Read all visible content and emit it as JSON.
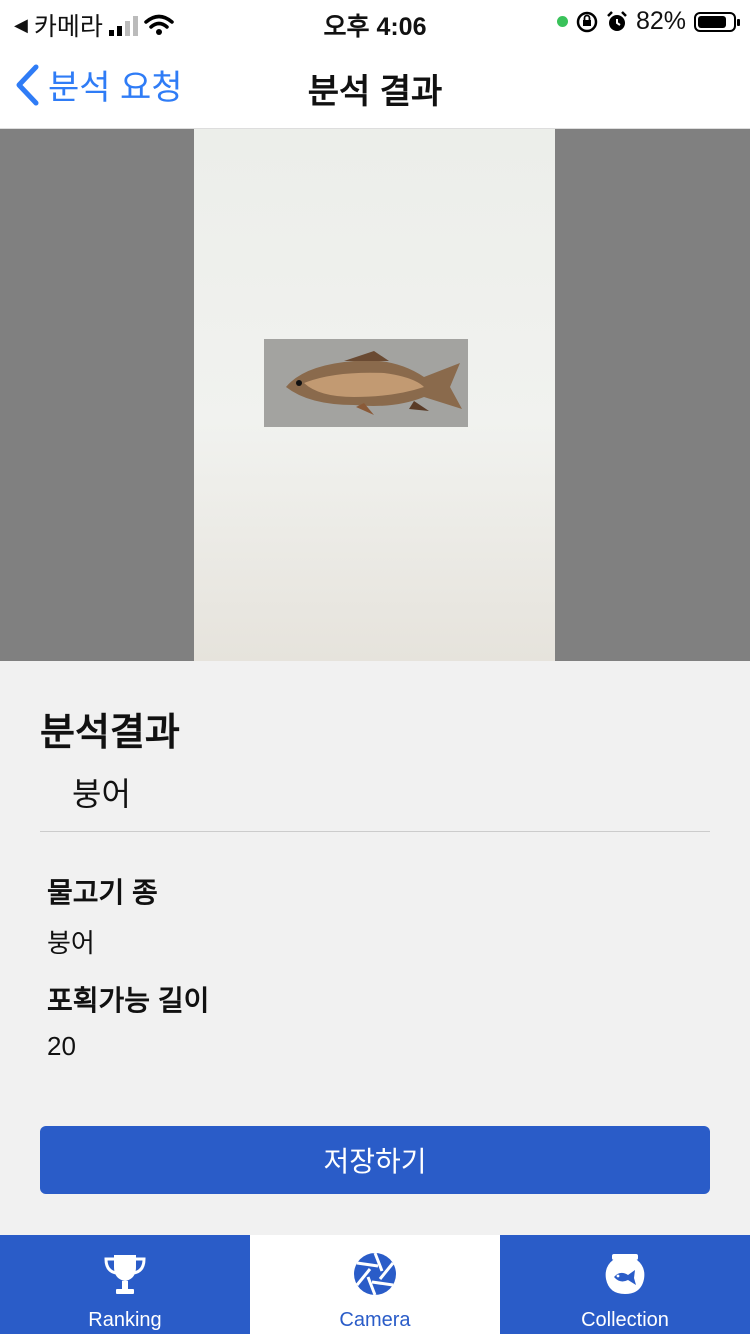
{
  "status_bar": {
    "back_app": "카메라",
    "time": "오후 4:06",
    "battery": "82%",
    "battery_level": 0.82
  },
  "navbar": {
    "back_label": "분석 요청",
    "title": "분석 결과"
  },
  "result": {
    "heading": "분석결과",
    "species_name": "붕어",
    "fields": [
      {
        "label": "물고기 종",
        "value": "붕어"
      },
      {
        "label": "포획가능 길이",
        "value": "20"
      }
    ],
    "save_button": "저장하기"
  },
  "tabbar": {
    "tabs": [
      {
        "label": "Ranking",
        "icon": "trophy-icon",
        "active": false
      },
      {
        "label": "Camera",
        "icon": "camera-aperture-icon",
        "active": true
      },
      {
        "label": "Collection",
        "icon": "fishbowl-icon",
        "active": false
      }
    ]
  },
  "colors": {
    "accent": "#2a5cc8",
    "ios_blue": "#2f7cf6",
    "tab_inactive_bg": "#2a5cc8",
    "tab_active_bg": "#ffffff"
  }
}
